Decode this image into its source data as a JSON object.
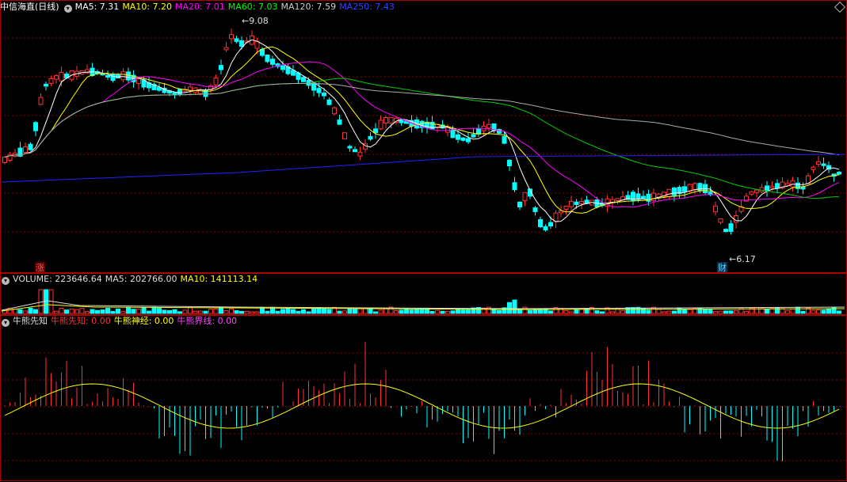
{
  "main": {
    "stock_name": "中信海直(日线)",
    "indicators": [
      {
        "label": "MA5: 7.31",
        "color": "#ffffff"
      },
      {
        "label": "MA10: 7.20",
        "color": "#ffff00"
      },
      {
        "label": "MA20: 7.01",
        "color": "#ff00ff"
      },
      {
        "label": "MA60: 7.03",
        "color": "#00ff00"
      },
      {
        "label": "MA120: 7.59",
        "color": "#cccccc"
      },
      {
        "label": "MA250: 7.43",
        "color": "#2222ff"
      }
    ],
    "high_label": "9.08",
    "low_label": "6.17",
    "badge_zhang": "涨",
    "badge_cai": "财"
  },
  "volume": {
    "title": "VOLUME: 223646.64",
    "ma5": "MA5: 202766.00",
    "ma10": "MA10: 141113.14"
  },
  "indicator": {
    "title": "牛熊先知",
    "items": [
      {
        "label": "牛熊先知: 0.00",
        "color": "#ff3333"
      },
      {
        "label": "牛熊神经: 0.00",
        "color": "#ffff00"
      },
      {
        "label": "牛熊界线: 0.00",
        "color": "#ff44ff"
      }
    ]
  },
  "colors": {
    "up": "#ff3333",
    "down": "#00ffff",
    "grid": "#8b0000",
    "border": "#aa0000"
  }
}
